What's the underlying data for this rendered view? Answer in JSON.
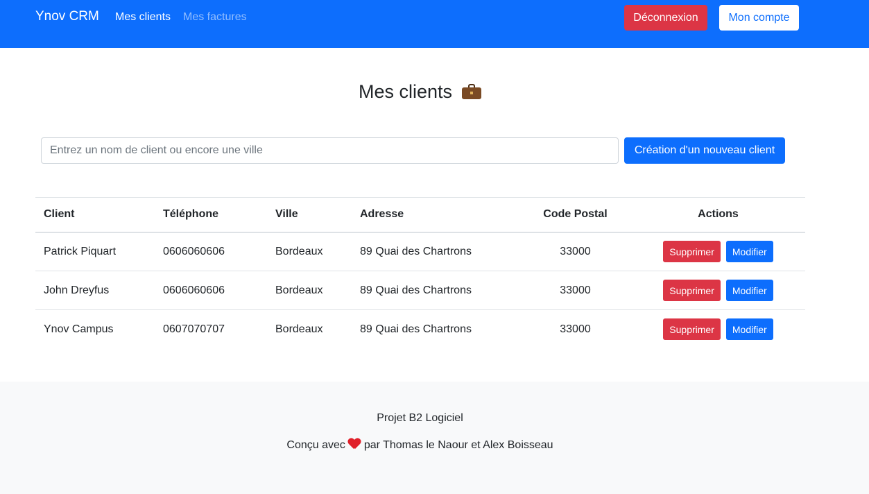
{
  "navbar": {
    "brand": "Ynov CRM",
    "links": [
      {
        "label": "Mes clients",
        "active": true
      },
      {
        "label": "Mes factures",
        "active": false
      }
    ],
    "logout_label": "Déconnexion",
    "account_label": "Mon compte"
  },
  "main": {
    "title": "Mes clients",
    "title_icon": "briefcase-icon",
    "search": {
      "value": "",
      "placeholder": "Entrez un nom de client ou encore une ville"
    },
    "create_label": "Création d'un nouveau client"
  },
  "table": {
    "columns": [
      "Client",
      "Téléphone",
      "Ville",
      "Adresse",
      "Code Postal",
      "Actions"
    ],
    "rows": [
      {
        "client": "Patrick Piquart",
        "phone": "0606060606",
        "city": "Bordeaux",
        "address": "89 Quai des Chartrons",
        "zip": "33000"
      },
      {
        "client": "John Dreyfus",
        "phone": "0606060606",
        "city": "Bordeaux",
        "address": "89 Quai des Chartrons",
        "zip": "33000"
      },
      {
        "client": "Ynov Campus",
        "phone": "0607070707",
        "city": "Bordeaux",
        "address": "89 Quai des Chartrons",
        "zip": "33000"
      }
    ],
    "delete_label": "Supprimer",
    "edit_label": "Modifier"
  },
  "footer": {
    "line1": "Projet B2 Logiciel",
    "line2_prefix": "Conçu avec",
    "line2_icon": "heart-icon",
    "line2_suffix": "par Thomas le Naour et Alex Boisseau"
  },
  "colors": {
    "primary": "#0d6efd",
    "danger": "#dc3545",
    "footer_bg": "#f8f9fa"
  }
}
